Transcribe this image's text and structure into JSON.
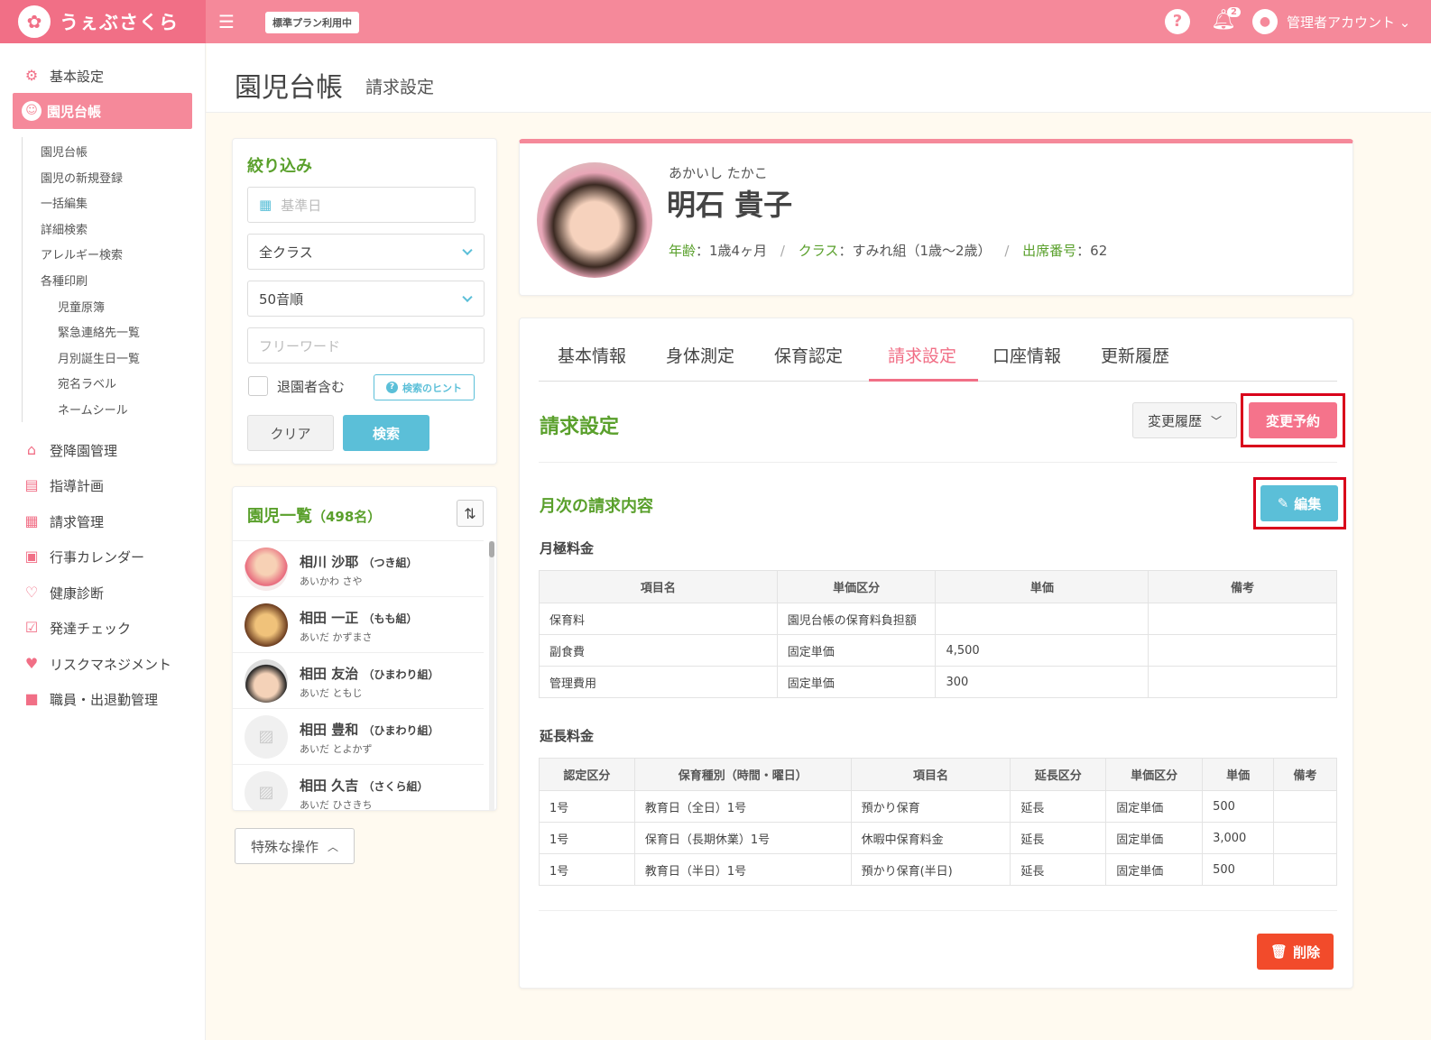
{
  "app": {
    "logo_text": "うぇぶさくら",
    "plan": "標準プラン利用中",
    "help": "?",
    "notification_count": "2",
    "account": "管理者アカウント"
  },
  "sidebar": {
    "basic": "基本設定",
    "active": "園児台帳",
    "sub": [
      "園児台帳",
      "園児の新規登録",
      "一括編集",
      "詳細検索",
      "アレルギー検索",
      "各種印刷"
    ],
    "print_sub": [
      "児童原簿",
      "緊急連絡先一覧",
      "月別誕生日一覧",
      "宛名ラベル",
      "ネームシール"
    ],
    "items": [
      "登降園管理",
      "指導計画",
      "請求管理",
      "行事カレンダー",
      "健康診断",
      "発達チェック",
      "リスクマネジメント",
      "職員・出退勤管理"
    ]
  },
  "page": {
    "title": "園児台帳",
    "subtitle": "請求設定"
  },
  "filter": {
    "title": "絞り込み",
    "date_placeholder": "基準日",
    "class_value": "全クラス",
    "order_value": "50音順",
    "keyword_placeholder": "フリーワード",
    "retired_label": "退園者含む",
    "hint": "検索のヒント",
    "clear": "クリア",
    "search": "検索"
  },
  "children": {
    "title": "園児一覧",
    "count": "（498名）",
    "list": [
      {
        "name": "相川 沙耶",
        "cls": "（つき組）",
        "kana": "あいかわ さや"
      },
      {
        "name": "相田 一正",
        "cls": "（もも組）",
        "kana": "あいだ かずまさ"
      },
      {
        "name": "相田 友治",
        "cls": "（ひまわり組）",
        "kana": "あいだ ともじ"
      },
      {
        "name": "相田 豊和",
        "cls": "（ひまわり組）",
        "kana": "あいだ とよかず"
      },
      {
        "name": "相田 久吉",
        "cls": "（さくら組）",
        "kana": "あいだ ひさきち"
      }
    ],
    "special": "特殊な操作"
  },
  "profile": {
    "kana": "あかいし たかこ",
    "name": "明石 貴子",
    "age_label": "年齢",
    "age": "：1歳4ヶ月",
    "class_label": "クラス",
    "class": "：すみれ組（1歳〜2歳）",
    "attend_label": "出席番号",
    "attend": "：62",
    "slash": "/"
  },
  "tabs": [
    "基本情報",
    "身体測定",
    "保育認定",
    "請求設定",
    "口座情報",
    "更新履歴"
  ],
  "billing": {
    "title": "請求設定",
    "history": "変更履歴",
    "reserve": "変更予約",
    "monthly_title": "月次の請求内容",
    "edit": "編集",
    "monthly_label": "月極料金",
    "monthly_headers": [
      "項目名",
      "単価区分",
      "単価",
      "備考"
    ],
    "monthly_rows": [
      [
        "保育料",
        "園児台帳の保育料負担額",
        "",
        ""
      ],
      [
        "副食費",
        "固定単価",
        "4,500",
        ""
      ],
      [
        "管理費用",
        "固定単価",
        "300",
        ""
      ]
    ],
    "ext_label": "延長料金",
    "ext_headers": [
      "認定区分",
      "保育種別（時間・曜日）",
      "項目名",
      "延長区分",
      "単価区分",
      "単価",
      "備考"
    ],
    "ext_rows": [
      [
        "1号",
        "教育日（全日）1号",
        "預かり保育",
        "延長",
        "固定単価",
        "500",
        ""
      ],
      [
        "1号",
        "保育日（長期休業）1号",
        "休暇中保育料金",
        "延長",
        "固定単価",
        "3,000",
        ""
      ],
      [
        "1号",
        "教育日（半日）1号",
        "預かり保育(半日)",
        "延長",
        "固定単価",
        "500",
        ""
      ]
    ],
    "delete": "削除"
  },
  "colors": {
    "brand": "#f5899a",
    "green": "#5aa02c",
    "blue": "#5bbfd8",
    "red": "#f24b2b"
  }
}
